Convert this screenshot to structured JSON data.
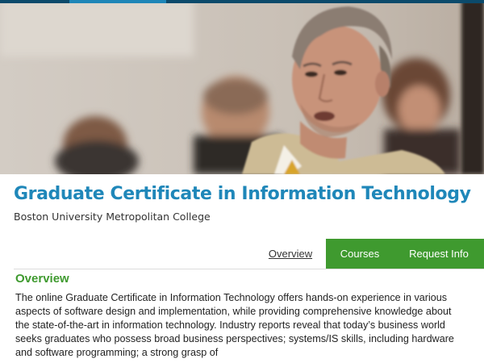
{
  "header": {
    "title": "Graduate Certificate in Information Technology",
    "subtitle": "Boston University Metropolitan College"
  },
  "tabs": [
    {
      "label": "Overview",
      "active": true
    },
    {
      "label": "Courses",
      "active": false
    },
    {
      "label": "Request Info",
      "active": false
    }
  ],
  "overview": {
    "heading": "Overview",
    "body": "The online Graduate Certificate in Information Technology offers hands-on experience in various aspects of software design and implementation, while providing comprehensive knowledge about the state-of-the-art in information technology. Industry reports reveal that today’s business world seeks graduates who possess broad business perspectives; systems/IS skills, including hardware and software programming; a strong grasp of"
  },
  "colors": {
    "title": "#1f87b9",
    "tab_bar": "#3f9a2f",
    "heading": "#3f9a2f"
  }
}
